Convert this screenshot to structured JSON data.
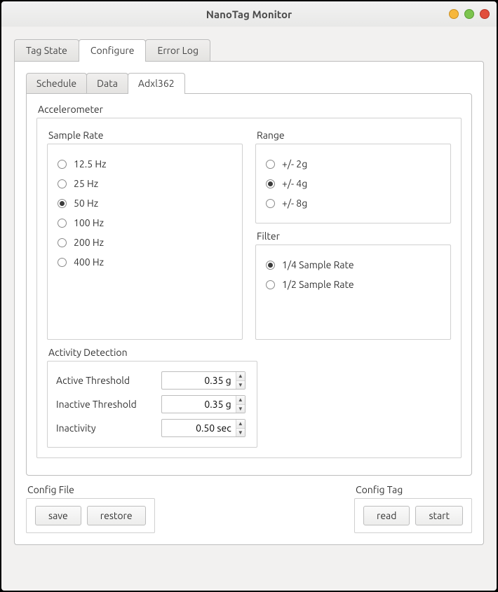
{
  "window": {
    "title": "NanoTag Monitor"
  },
  "tabs": {
    "primary": [
      {
        "label": "Tag State",
        "active": false
      },
      {
        "label": "Configure",
        "active": true
      },
      {
        "label": "Error Log",
        "active": false
      }
    ],
    "inner": [
      {
        "label": "Schedule",
        "active": false
      },
      {
        "label": "Data",
        "active": false
      },
      {
        "label": "Adxl362",
        "active": true
      }
    ]
  },
  "accelerometer": {
    "title": "Accelerometer",
    "sample_rate": {
      "title": "Sample Rate",
      "options": [
        {
          "label": "12.5 Hz",
          "selected": false
        },
        {
          "label": "25 Hz",
          "selected": false
        },
        {
          "label": "50 Hz",
          "selected": true
        },
        {
          "label": "100 Hz",
          "selected": false
        },
        {
          "label": "200 Hz",
          "selected": false
        },
        {
          "label": "400 Hz",
          "selected": false
        }
      ]
    },
    "range": {
      "title": "Range",
      "options": [
        {
          "label": "+/- 2g",
          "selected": false
        },
        {
          "label": "+/- 4g",
          "selected": true
        },
        {
          "label": "+/- 8g",
          "selected": false
        }
      ]
    },
    "filter": {
      "title": "Filter",
      "options": [
        {
          "label": "1/4 Sample Rate",
          "selected": true
        },
        {
          "label": "1/2 Sample Rate",
          "selected": false
        }
      ]
    },
    "activity": {
      "title": "Activity Detection",
      "active_threshold": {
        "label": "Active Threshold",
        "value": "0.35 g"
      },
      "inactive_threshold": {
        "label": "Inactive Threshold",
        "value": "0.35 g"
      },
      "inactivity": {
        "label": "Inactivity",
        "value": "0.50 sec"
      }
    }
  },
  "config_file": {
    "title": "Config File",
    "save": "save",
    "restore": "restore"
  },
  "config_tag": {
    "title": "Config Tag",
    "read": "read",
    "start": "start"
  }
}
